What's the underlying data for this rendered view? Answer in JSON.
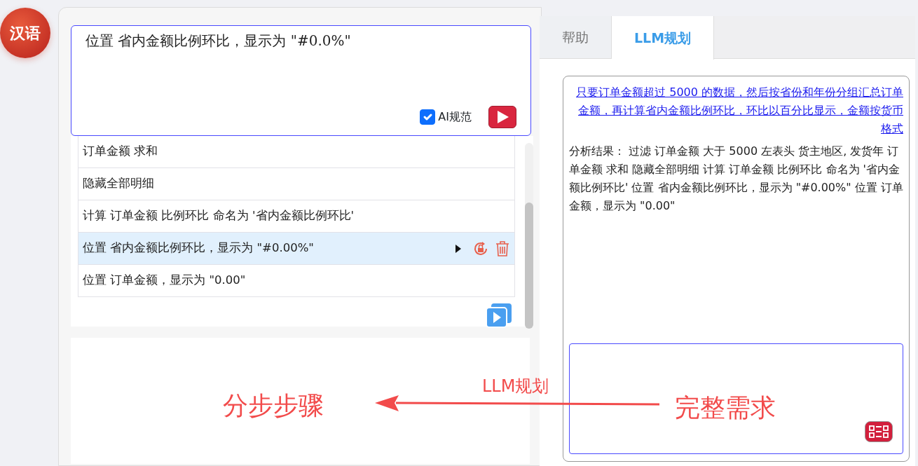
{
  "language_button": "汉语",
  "command_input": {
    "value": "位置 省内金额比例环比，显示为 \"#0.0%\"",
    "ai_checkbox": {
      "label": "AI规范",
      "checked": true
    }
  },
  "steps": [
    {
      "text": "订单金额 求和",
      "selected": false
    },
    {
      "text": "隐藏全部明细",
      "selected": false
    },
    {
      "text": "计算 订单金额 比例环比 命名为 '省内金额比例环比'",
      "selected": false
    },
    {
      "text": "位置 省内金额比例环比，显示为 \"#0.00%\"",
      "selected": true
    },
    {
      "text": "位置 订单金额，显示为 \"0.00\"",
      "selected": false
    }
  ],
  "tabs": [
    {
      "label": "帮助",
      "selected": false
    },
    {
      "label": "LLM规划",
      "selected": true
    }
  ],
  "llm_panel": {
    "request_link": "只要订单金额超过 5000 的数据，然后按省份和年份分组汇总订单金额，再计算省内金额比例环比，环比以百分比显示，金额按货币格式",
    "analysis": "分析结果： 过滤 订单金额 大于 5000 左表头 货主地区, 发货年 订单金额 求和 隐藏全部明细 计算 订单金额 比例环比 命名为 '省内金额比例环比' 位置 省内金额比例环比，显示为 \"#0.00%\" 位置 订单金额，显示为 \"0.00\""
  },
  "annotation": {
    "left_label": "分步步骤",
    "arrow_label": "LLM规划",
    "right_label": "完整需求"
  }
}
